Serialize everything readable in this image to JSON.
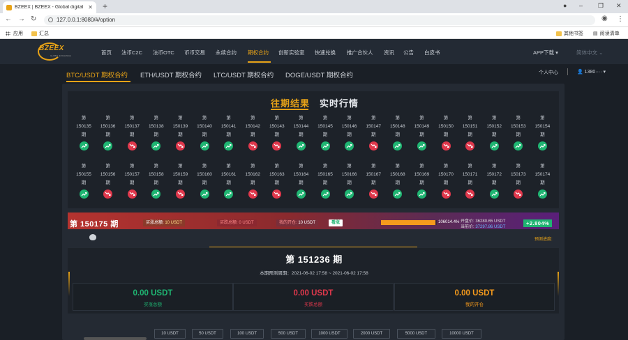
{
  "browser": {
    "tab_title": "BZEEX | BZEEX - Global digital",
    "url": "127.0.0.1:8080/#/option",
    "bookmarks": [
      "应用",
      "汇总"
    ],
    "bookmarks_right": [
      "其他书签",
      "阅读清单"
    ]
  },
  "site": {
    "logo": "BZEEX",
    "logo_sub": "GLOBAL EXCHANGE",
    "nav": [
      "首页",
      "法币C2C",
      "法币OTC",
      "币币交易",
      "永续合约",
      "期权合约",
      "创新实验室",
      "快速兑换",
      "推广合伙人",
      "资讯",
      "公告",
      "白皮书"
    ],
    "active_nav": "期权合约",
    "app_download": "APP下载",
    "language": "简体中文",
    "personal_center": "个人中心",
    "username": "1380····"
  },
  "subtabs": [
    "BTC/USDT 期权合约",
    "ETH/USDT 期权合约",
    "LTC/USDT 期权合约",
    "DOGE/USDT 期权合约"
  ],
  "active_subtab": "BTC/USDT 期权合约",
  "history": {
    "tab_past": "往期结果",
    "tab_live": "实时行情",
    "prefix": "第",
    "suffix": "期",
    "rows": [
      [
        {
          "n": "150135",
          "r": "up"
        },
        {
          "n": "150136",
          "r": "up"
        },
        {
          "n": "150137",
          "r": "dn"
        },
        {
          "n": "150138",
          "r": "up"
        },
        {
          "n": "150139",
          "r": "dn"
        },
        {
          "n": "150140",
          "r": "up"
        },
        {
          "n": "150141",
          "r": "up"
        },
        {
          "n": "150142",
          "r": "dn"
        },
        {
          "n": "150143",
          "r": "dn"
        },
        {
          "n": "150144",
          "r": "up"
        },
        {
          "n": "150145",
          "r": "up"
        },
        {
          "n": "150146",
          "r": "up"
        },
        {
          "n": "150147",
          "r": "dn"
        },
        {
          "n": "150148",
          "r": "up"
        },
        {
          "n": "150149",
          "r": "up"
        },
        {
          "n": "150150",
          "r": "dn"
        },
        {
          "n": "150151",
          "r": "dn"
        },
        {
          "n": "150152",
          "r": "up"
        },
        {
          "n": "150153",
          "r": "up"
        },
        {
          "n": "150154",
          "r": "up"
        }
      ],
      [
        {
          "n": "150155",
          "r": "up"
        },
        {
          "n": "150156",
          "r": "dn"
        },
        {
          "n": "150157",
          "r": "dn"
        },
        {
          "n": "150158",
          "r": "up"
        },
        {
          "n": "150159",
          "r": "dn"
        },
        {
          "n": "150160",
          "r": "up"
        },
        {
          "n": "150161",
          "r": "up"
        },
        {
          "n": "150162",
          "r": "dn"
        },
        {
          "n": "150163",
          "r": "dn"
        },
        {
          "n": "150164",
          "r": "up"
        },
        {
          "n": "150165",
          "r": "up"
        },
        {
          "n": "150166",
          "r": "up"
        },
        {
          "n": "150167",
          "r": "dn"
        },
        {
          "n": "150168",
          "r": "up"
        },
        {
          "n": "150169",
          "r": "up"
        },
        {
          "n": "150170",
          "r": "dn"
        },
        {
          "n": "150171",
          "r": "dn"
        },
        {
          "n": "150172",
          "r": "up"
        },
        {
          "n": "150173",
          "r": "dn"
        },
        {
          "n": "150174",
          "r": "up"
        }
      ]
    ]
  },
  "status": {
    "period": "第 150175 期",
    "buy_up_label": "买涨总额:",
    "buy_up_value": "10 USDT",
    "buy_down_label": "买跌总额:",
    "buy_down_value": "0 USDT",
    "my_open_label": "我的开仓:",
    "my_open_value": "10 USDT",
    "up_button": "看涨",
    "progress_fraction": 0.97,
    "progress_text": "106014.4%",
    "open_price_label": "开盘价:",
    "open_price": "36280.65 USDT",
    "current_price_label": "当前价:",
    "current_price": "37297.86 USDT",
    "change": "+2.804%"
  },
  "prediction_label": "预测进度:",
  "current": {
    "title": "第 151236 期",
    "range": "本期预测周期：2021-06-02 17:58 ~ 2021-06-02 17:58",
    "buy_up_total": "0.00 USDT",
    "buy_up_label": "买涨总额",
    "buy_down_total": "0.00 USDT",
    "buy_down_label": "买跌总额",
    "my_open": "0.00 USDT",
    "my_open_label": "我的开仓"
  },
  "amounts": [
    "10 USDT",
    "50 USDT",
    "100 USDT",
    "500 USDT",
    "1000 USDT",
    "2000 USDT",
    "5000 USDT",
    "10000 USDT"
  ],
  "colors": {
    "accent": "#e8a317",
    "up": "#1fb572",
    "down": "#e0384c"
  }
}
